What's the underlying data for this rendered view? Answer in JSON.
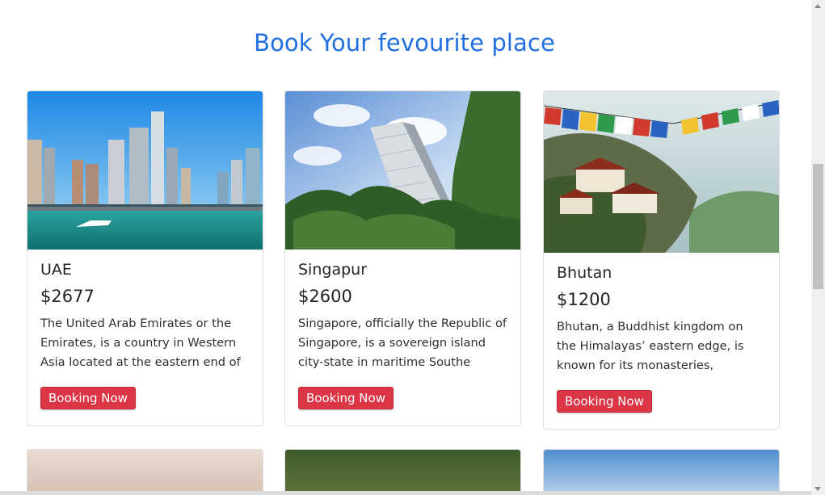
{
  "heading": "Book Your fevourite place",
  "button_label": "Booking Now",
  "cards": [
    {
      "name": "UAE",
      "price": "$2677",
      "description": "The United Arab Emirates or the Emirates, is a country in Western Asia located at the eastern end of"
    },
    {
      "name": "Singapur",
      "price": "$2600",
      "description": "Singapore, officially the Republic of Singapore, is a sovereign island city-state in maritime Southe"
    },
    {
      "name": "Bhutan",
      "price": "$1200",
      "description": "Bhutan, a Buddhist kingdom on the Himalayas’ eastern edge, is known for its monasteries, fortresses"
    }
  ],
  "colors": {
    "heading": "#1f6fe0",
    "button": "#dc3545"
  }
}
